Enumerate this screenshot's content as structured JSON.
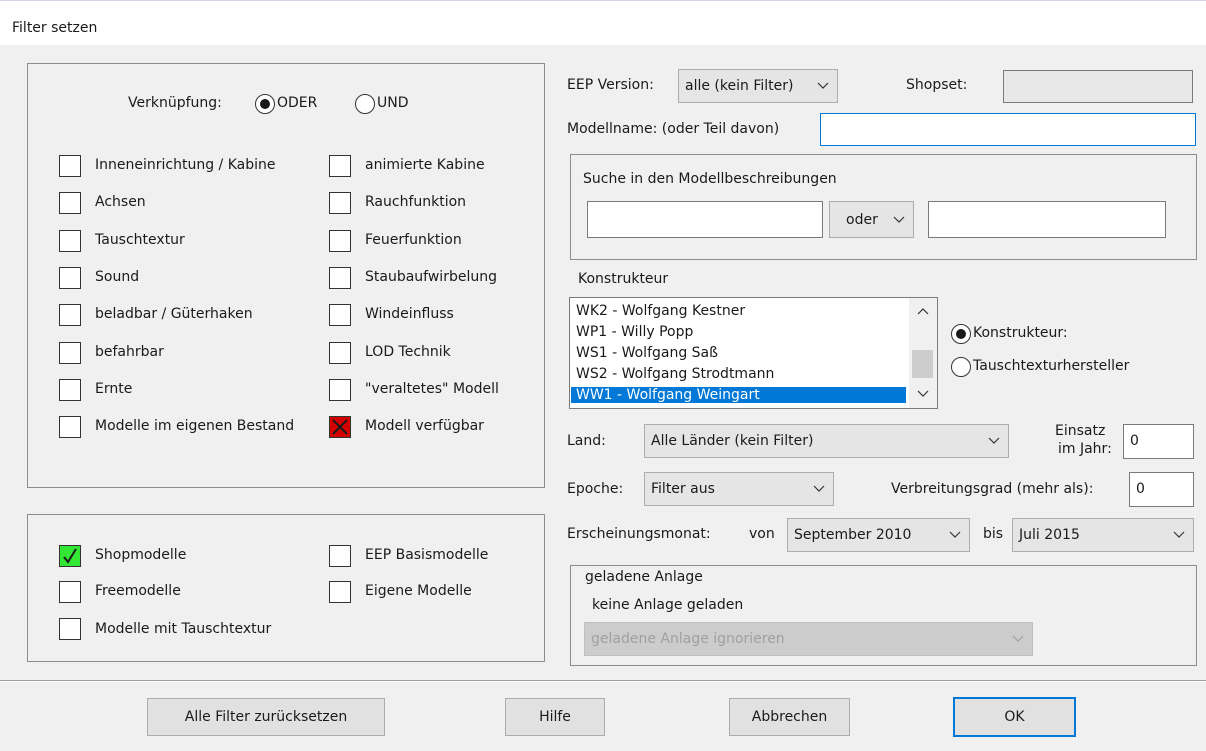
{
  "window": {
    "title": "Filter setzen"
  },
  "left": {
    "verknuepfung_label": "Verknüpfung:",
    "radio_oder": "ODER",
    "radio_und": "UND",
    "checkboxes_col1": [
      "Inneneinrichtung / Kabine",
      "Achsen",
      "Tauschtextur",
      "Sound",
      "beladbar / Güterhaken",
      "befahrbar",
      "Ernte",
      "Modelle im eigenen Bestand"
    ],
    "checkboxes_col2": [
      "animierte Kabine",
      "Rauchfunktion",
      "Feuerfunktion",
      "Staubaufwirbelung",
      "Windeinfluss",
      "LOD Technik",
      "\"veraltetes\" Modell",
      "Modell verfügbar"
    ]
  },
  "bottom_left": {
    "shopmodelle": "Shopmodelle",
    "freemodelle": "Freemodelle",
    "tauschtextur": "Modelle mit Tauschtextur",
    "eep_basis": "EEP Basismodelle",
    "eigene": "Eigene Modelle"
  },
  "right": {
    "eep_version_label": "EEP Version:",
    "eep_version_value": "alle (kein Filter)",
    "shopset_label": "Shopset:",
    "shopset_value": "",
    "modellname_label": "Modellname: (oder Teil davon)",
    "modellname_value": "",
    "suche_title": "Suche in den Modellbeschreibungen",
    "suche_field1": "",
    "suche_op": "oder",
    "suche_field2": "",
    "konstrukteur_label": "Konstrukteur",
    "konstrukteur_items": [
      "WK2 - Wolfgang Kestner",
      "WP1 - Willy Popp",
      "WS1 - Wolfgang Saß",
      "WS2 - Wolfgang Strodtmann",
      "WW1 - Wolfgang Weingart"
    ],
    "radio_konstrukteur": "Konstrukteur:",
    "radio_tauschtextur": "Tauschtexturhersteller",
    "land_label": "Land:",
    "land_value": "Alle Länder (kein Filter)",
    "einsatz_label1": "Einsatz",
    "einsatz_label2": "im Jahr:",
    "einsatz_value": "0",
    "epoche_label": "Epoche:",
    "epoche_value": "Filter aus",
    "verbreitung_label": "Verbreitungsgrad (mehr als):",
    "verbreitung_value": "0",
    "erscheinung_label": "Erscheinungsmonat:",
    "von_label": "von",
    "von_value": "September 2010",
    "bis_label": "bis",
    "bis_value": "Juli 2015",
    "anlage_title": "geladene Anlage",
    "anlage_status": "keine Anlage geladen",
    "anlage_select": "geladene Anlage ignorieren"
  },
  "buttons": {
    "reset": "Alle Filter zurücksetzen",
    "help": "Hilfe",
    "cancel": "Abbrechen",
    "ok": "OK"
  }
}
